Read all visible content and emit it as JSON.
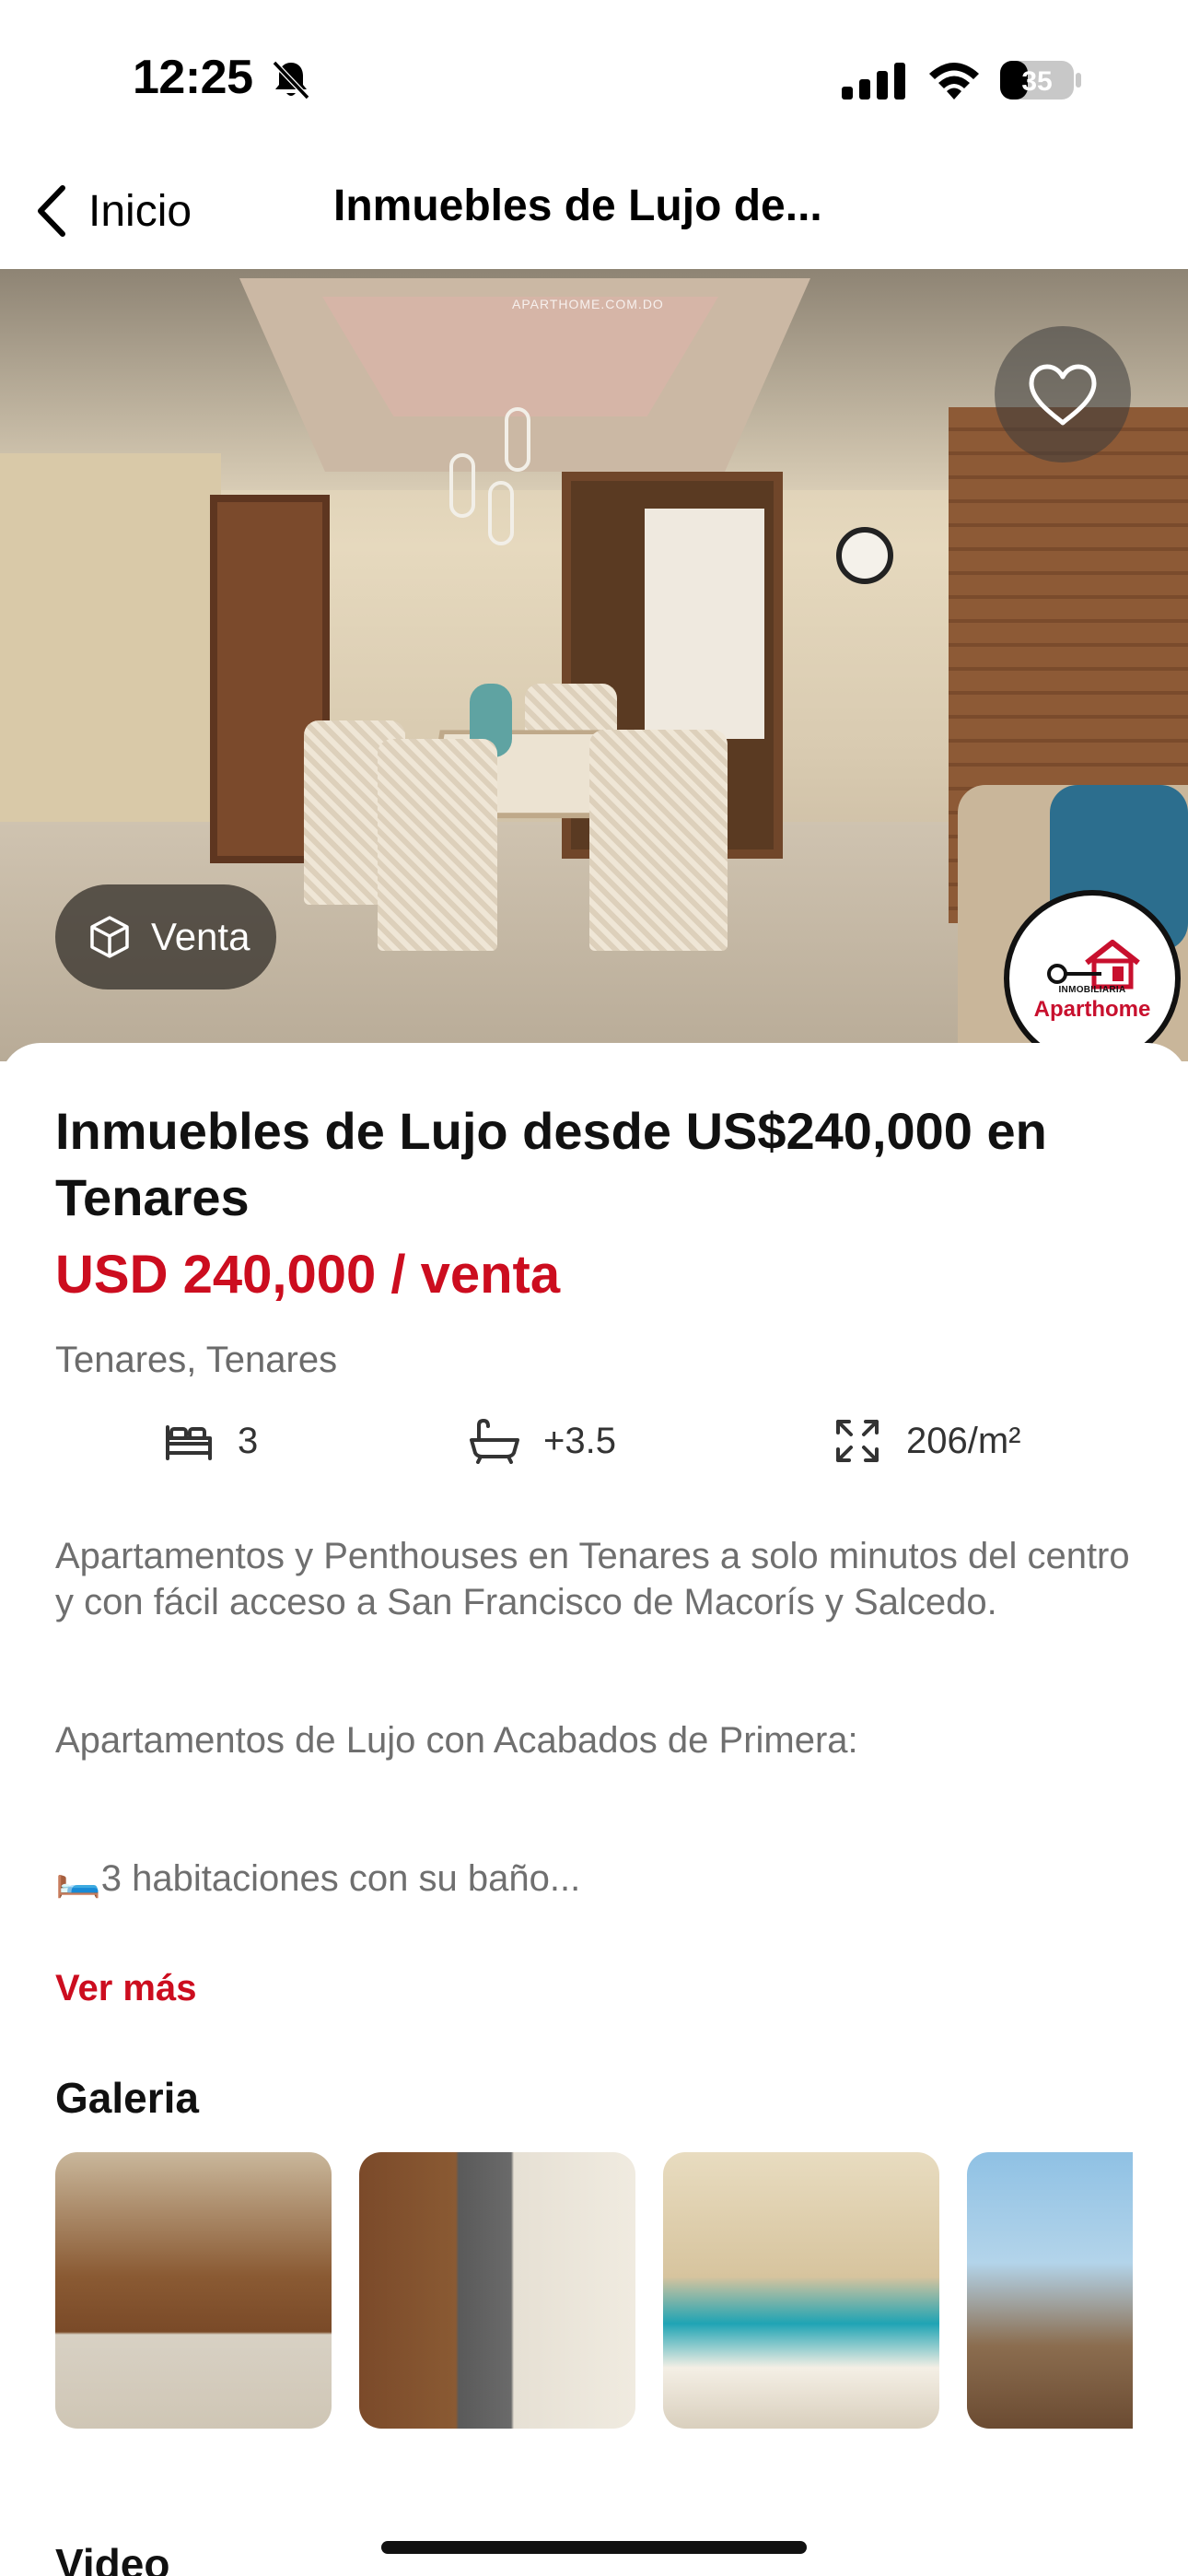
{
  "status_bar": {
    "time": "12:25",
    "battery_level": "35",
    "icons": [
      "bell-slash-icon",
      "cellular-signal-icon",
      "wifi-icon",
      "battery-icon"
    ]
  },
  "nav": {
    "back_label": "Inicio",
    "title": "Inmuebles de Lujo de..."
  },
  "hero": {
    "watermark": "APARTHOME.COM.DO",
    "operation_chip": "Venta",
    "agency_small": "INMOBILIARIA",
    "agency_name": "Aparthome"
  },
  "listing": {
    "title": "Inmuebles de Lujo desde US$240,000 en Tenares",
    "price": "USD 240,000 / venta",
    "location": "Tenares, Tenares",
    "features": {
      "bedrooms": "3",
      "bathrooms": "+3.5",
      "area": "206/m²"
    },
    "description": [
      "Apartamentos y Penthouses en Tenares a solo minutos del centro y con fácil acceso a San Francisco de Macorís y Salcedo.",
      "Apartamentos de Lujo con Acabados de Primera:",
      "🛏️3 habitaciones con su baño..."
    ],
    "see_more": "Ver más"
  },
  "gallery": {
    "title": "Galeria",
    "thumbnails": [
      "kitchen",
      "kitchen-dining",
      "living-room",
      "balcony-view"
    ]
  },
  "video": {
    "title": "Video"
  },
  "colors": {
    "accent_red": "#cc0d1f",
    "muted_text": "#6f6f6f"
  }
}
